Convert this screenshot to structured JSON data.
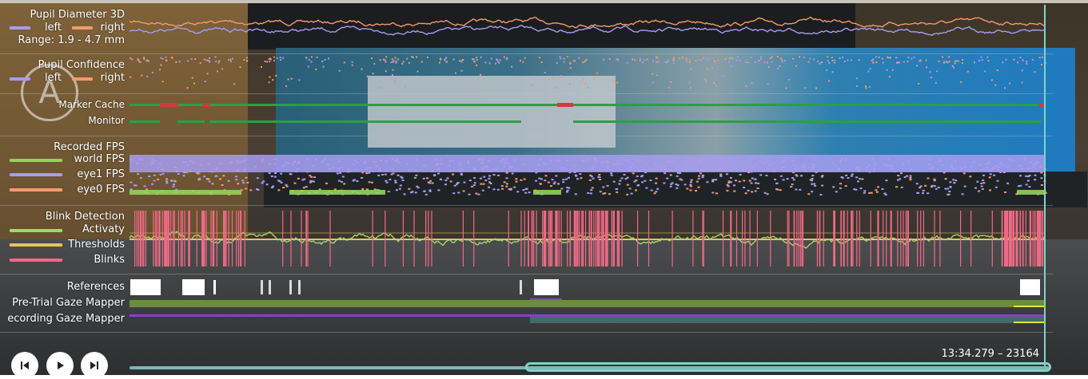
{
  "colors": {
    "left": "#a79cf0",
    "right": "#f59a6a",
    "cache_green": "#2aa042",
    "cache_red": "#d33a3a",
    "world": "#93d35a",
    "eye1": "#a79cf0",
    "eye0": "#f59a6a",
    "activity": "#a2d76a",
    "threshold": "#e6c25e",
    "blink": "#ef6a86",
    "pretrial": "#6d8c3f",
    "recording": "#8a3fc4",
    "accent": "#7fd3c8"
  },
  "pupil_diameter": {
    "title": "Pupil Diameter 3D",
    "left_label": "left",
    "right_label": "right",
    "range_label": "Range: 1.9 - 4.7 mm"
  },
  "pupil_confidence": {
    "title": "Pupil Confidence",
    "left_label": "left",
    "right_label": "right"
  },
  "markers": {
    "cache_label": "Marker Cache",
    "monitor_label": "Monitor"
  },
  "fps": {
    "title": "Recorded FPS",
    "world_label": "world FPS",
    "eye1_label": "eye1 FPS",
    "eye0_label": "eye0 FPS"
  },
  "blink": {
    "title": "Blink Detection",
    "activity_label": "Activaty",
    "threshold_label": "Thresholds",
    "blinks_label": "Blinks"
  },
  "references": {
    "title": "References",
    "pretrial_label": "Pre-Trial Gaze Mapper",
    "recording_label": "ecording Gaze Mapper"
  },
  "playback": {
    "prev_icon": "skip-back-icon",
    "play_icon": "play-icon",
    "next_icon": "skip-forward-icon",
    "time_readout": "13:34.279 – 23164"
  },
  "logo": {
    "letter": "A"
  }
}
